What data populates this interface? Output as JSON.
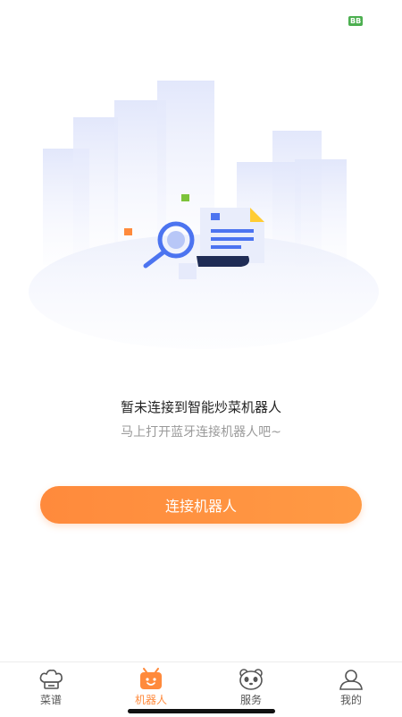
{
  "status": {
    "tag": "BB"
  },
  "empty_state": {
    "title": "暂未连接到智能炒菜机器人",
    "subtitle": "马上打开蓝牙连接机器人吧~"
  },
  "connect_button": {
    "label": "连接机器人"
  },
  "tabbar": {
    "items": [
      {
        "label": "菜谱",
        "icon": "chef-hat-icon",
        "active": false
      },
      {
        "label": "机器人",
        "icon": "robot-icon",
        "active": true
      },
      {
        "label": "服务",
        "icon": "panda-icon",
        "active": false
      },
      {
        "label": "我的",
        "icon": "user-icon",
        "active": false
      }
    ]
  },
  "colors": {
    "accent": "#ff8a3c",
    "muted_text": "#9a9a9a"
  }
}
